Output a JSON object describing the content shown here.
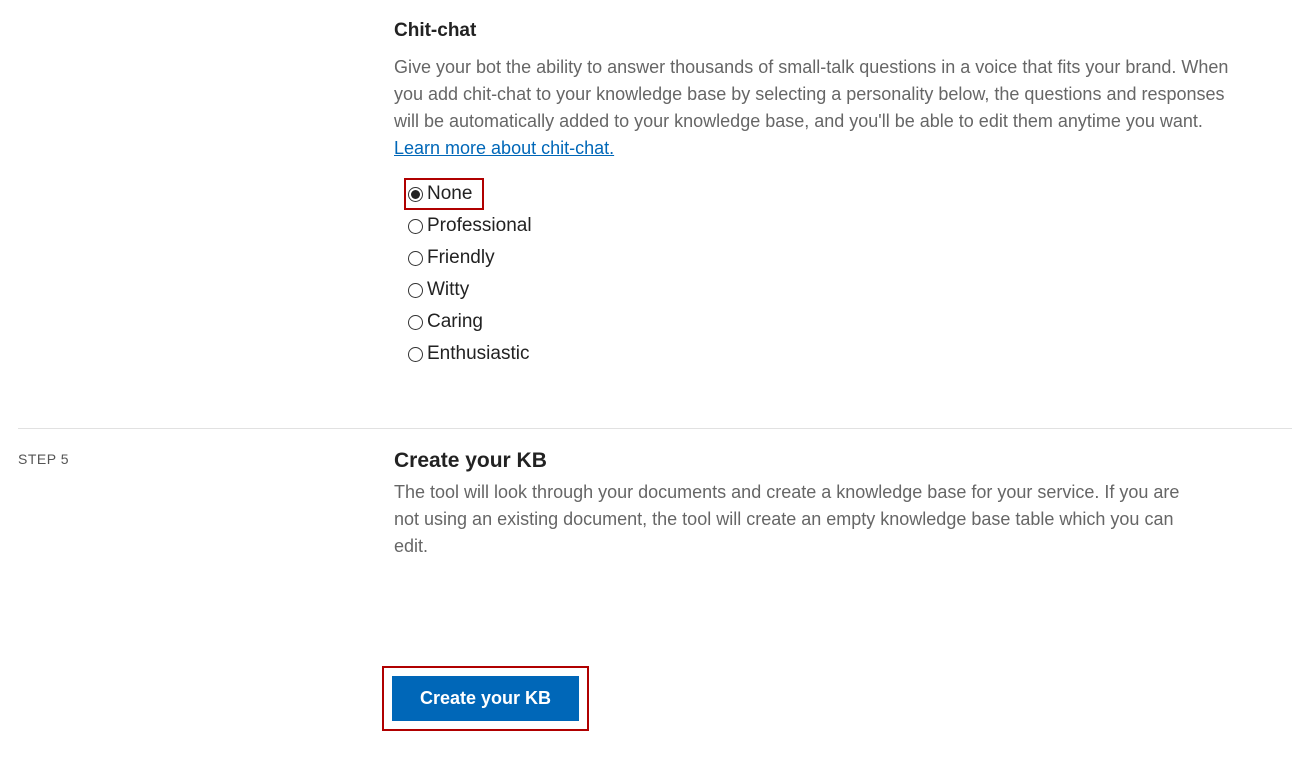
{
  "step4": {
    "title": "Chit-chat",
    "description_1": "Give your bot the ability to answer thousands of small-talk questions in a voice that fits your brand. When you add chit-chat to your knowledge base by selecting a personality below, the questions and responses will be automatically added to your knowledge base, and you'll be able to edit them anytime you want. ",
    "learn_more": "Learn more about chit-chat.",
    "options": {
      "none": "None",
      "professional": "Professional",
      "friendly": "Friendly",
      "witty": "Witty",
      "caring": "Caring",
      "enthusiastic": "Enthusiastic"
    }
  },
  "step5": {
    "label": "STEP 5",
    "title": "Create your KB",
    "description": "The tool will look through your documents and create a knowledge base for your service. If you are not using an existing document, the tool will create an empty knowledge base table which you can edit.",
    "button": "Create your KB"
  }
}
